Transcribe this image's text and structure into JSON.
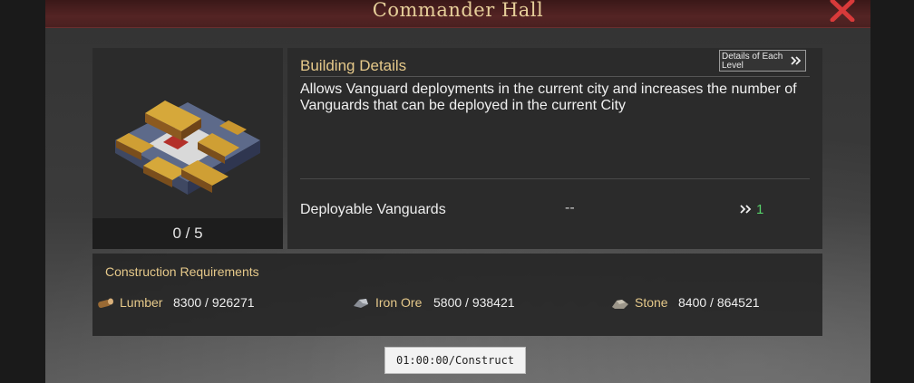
{
  "dialog": {
    "title": "Commander Hall"
  },
  "building": {
    "level_text": "0 / 5",
    "image": "commander-hall-building"
  },
  "details": {
    "heading": "Building Details",
    "each_level_button": "Details of Each Level",
    "description": "Allows Vanguard deployments in the current city and increases the number of Vanguards that can be deployed in the current City",
    "stat": {
      "label": "Deployable Vanguards",
      "current": "--",
      "next": "1"
    }
  },
  "requirements": {
    "heading": "Construction Requirements",
    "items": [
      {
        "icon": "lumber-icon",
        "name": "Lumber",
        "amount": "8300 / 926271"
      },
      {
        "icon": "iron-ore-icon",
        "name": "Iron Ore",
        "amount": "5800 / 938421"
      },
      {
        "icon": "stone-icon",
        "name": "Stone",
        "amount": "8400 / 864521"
      }
    ]
  },
  "construct_button": "01:00:00/Construct",
  "colors": {
    "title_gold": "#e6cf9a",
    "heading_gold": "#e6c98a",
    "close_red": "#d83a3a",
    "next_green": "#56d16a",
    "title_bar_red": "#542424"
  }
}
